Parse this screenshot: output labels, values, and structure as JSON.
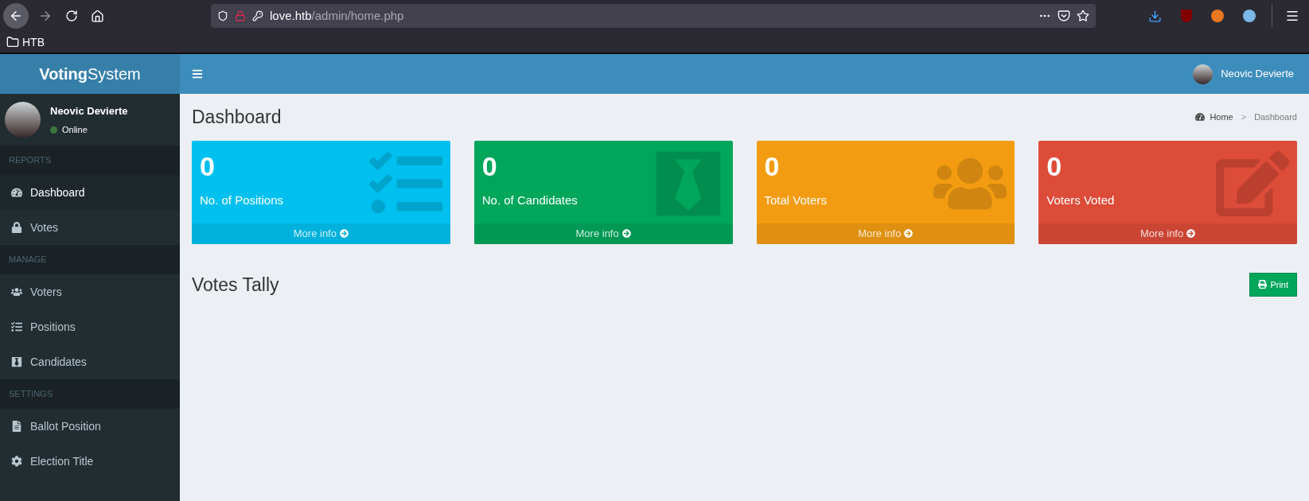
{
  "browser": {
    "url_host": "love.htb",
    "url_path": "/admin/home.php",
    "bookmarks": [
      {
        "label": "HTB"
      }
    ]
  },
  "logo": "**Voting**System",
  "header": {
    "user_name": "Neovic Devierte"
  },
  "sidebar": {
    "user_name": "Neovic Devierte",
    "status": "Online",
    "sections": [
      {
        "title": "REPORTS",
        "items": [
          {
            "label": "Dashboard",
            "selected": true
          },
          {
            "label": "Votes",
            "selected": false
          }
        ]
      },
      {
        "title": "MANAGE",
        "items": [
          {
            "label": "Voters",
            "selected": false
          },
          {
            "label": "Positions",
            "selected": false
          },
          {
            "label": "Candidates",
            "selected": false
          }
        ]
      },
      {
        "title": "SETTINGS",
        "items": [
          {
            "label": "Ballot Position",
            "selected": false
          },
          {
            "label": "Election Title",
            "selected": false
          }
        ]
      }
    ]
  },
  "page_title": "Dashboard",
  "breadcrumb": [
    {
      "label": "Home"
    },
    {
      "separator": ">"
    },
    {
      "label": "Dashboard"
    }
  ],
  "cards": [
    {
      "value": "0",
      "label": "No. of Positions",
      "link": "More info",
      "color": "#00c0ef"
    },
    {
      "value": "0",
      "label": "No. of Candidates",
      "link": "More info",
      "color": "#00a65a"
    },
    {
      "value": "0",
      "label": "Total Voters",
      "link": "More info",
      "color": "#f39c12"
    },
    {
      "value": "0",
      "label": "Voters Voted",
      "link": "More info",
      "color": "#dd4b39"
    }
  ],
  "tally": {
    "title": "Votes Tally",
    "print_button": "Print"
  }
}
